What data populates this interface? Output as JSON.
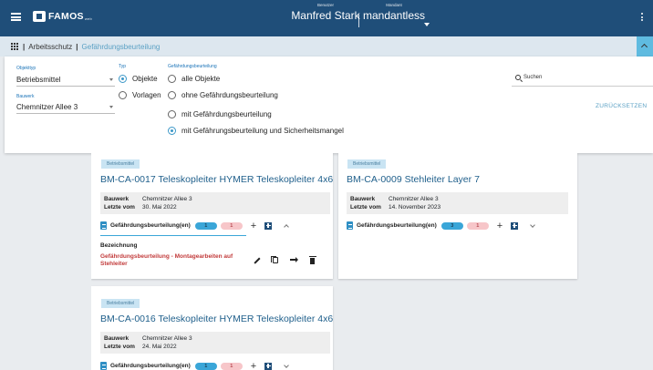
{
  "app": {
    "logo_text": "FAMOS",
    "logo_sub": "web"
  },
  "header": {
    "user_label": "Benutzer",
    "user_name": "Manfred Stark",
    "tenant_label": "Mandant",
    "tenant_name": "mandantless"
  },
  "breadcrumb": [
    {
      "label": "Arbeitsschutz"
    },
    {
      "label": "Gefährdungsbeurteilung"
    }
  ],
  "filters": {
    "objekttyp_label": "Objekttyp",
    "objekttyp_value": "Betriebsmittel",
    "bauwerk_label": "Bauwerk",
    "bauwerk_value": "Chemnitzer Allee 3",
    "typ_label": "Typ",
    "typ_options": [
      {
        "label": "Objekte",
        "selected": true
      },
      {
        "label": "Vorlagen",
        "selected": false
      }
    ],
    "gb_label": "Gefährdungsbeurteilung",
    "gb_options": [
      {
        "label": "alle Objekte",
        "selected": false
      },
      {
        "label": "ohne Gefährdungsbeurteilung",
        "selected": false
      },
      {
        "label": "mit Gefährdungsbeurteilung",
        "selected": false
      },
      {
        "label": "mit Gefährungsbeurteilung und Sicherheitsmangel",
        "selected": true
      }
    ],
    "search_placeholder": "Suchen",
    "reset_label": "ZURÜCKSETZEN"
  },
  "cards": [
    {
      "tag": "Betriebsmittel",
      "title": "BM-CA-0017 Teleskopleiter HYMER Teleskopleiter 4x6",
      "bauwerk_key": "Bauwerk",
      "bauwerk_val": "Chemnitzer Allee 3",
      "letzte_key": "Letzte vom",
      "letzte_val": "30. Mai 2022",
      "gb_label": "Gefährdungsbeurteilung(en)",
      "count_blue": "1",
      "count_red": "1",
      "expanded": true,
      "sub_header": "Bezeichnung",
      "sub_item": "Gefährdungsbeurteilung - Montagearbeiten auf Stehleiter"
    },
    {
      "tag": "Betriebsmittel",
      "title": "BM-CA-0009 Stehleiter Layer 7",
      "bauwerk_key": "Bauwerk",
      "bauwerk_val": "Chemnitzer Allee 3",
      "letzte_key": "Letzte vom",
      "letzte_val": "14. November 2023",
      "gb_label": "Gefährdungsbeurteilung(en)",
      "count_blue": "3",
      "count_red": "1",
      "expanded": false
    },
    {
      "tag": "Betriebsmittel",
      "title": "BM-CA-0016 Teleskopleiter HYMER Teleskopleiter 4x6",
      "bauwerk_key": "Bauwerk",
      "bauwerk_val": "Chemnitzer Allee 3",
      "letzte_key": "Letzte vom",
      "letzte_val": "24. Mai 2022",
      "gb_label": "Gefährdungsbeurteilung(en)",
      "count_blue": "1",
      "count_red": "1",
      "expanded": false
    }
  ],
  "colors": {
    "primary": "#1f4e79",
    "accent": "#3aa6d8",
    "danger": "#c23b3b"
  }
}
